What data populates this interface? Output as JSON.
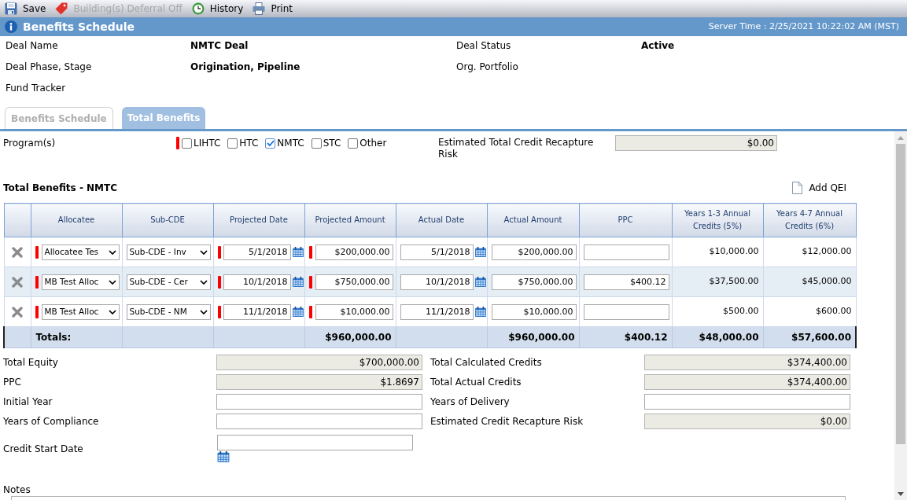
{
  "toolbar": [
    {
      "kind": "save",
      "label": "Save",
      "disabled": false
    },
    {
      "kind": "tag",
      "label": "Building(s) Deferral Off",
      "disabled": true
    },
    {
      "kind": "history",
      "label": "History",
      "disabled": false
    },
    {
      "kind": "print",
      "label": "Print",
      "disabled": false
    }
  ],
  "header": {
    "title": "Benefits Schedule",
    "server_time": "Server Time : 2/25/2021 10:22:02 AM (MST)"
  },
  "deal_info": [
    {
      "fields": [
        {
          "label": "Deal Name",
          "value": "NMTC Deal"
        },
        {
          "label": "Deal Status",
          "value": "Active"
        }
      ]
    },
    {
      "fields": [
        {
          "label": "Deal Phase, Stage",
          "value": "Origination, Pipeline"
        },
        {
          "label": "Org. Portfolio"
        }
      ]
    },
    {
      "fields": [
        {
          "label": "Fund Tracker"
        }
      ]
    }
  ],
  "tabs": [
    {
      "label": "Benefits Schedule",
      "selected": false
    },
    {
      "label": "Total Benefits",
      "selected": true
    }
  ],
  "programs": {
    "label": "Program(s)",
    "required": true,
    "options": [
      {
        "label": "LIHTC",
        "checked": false
      },
      {
        "label": "HTC",
        "checked": false
      },
      {
        "label": "NMTC",
        "checked": true
      },
      {
        "label": "STC",
        "checked": false
      },
      {
        "label": "Other",
        "checked": false
      }
    ]
  },
  "recapture_risk": {
    "label": "Estimated Total Credit Recapture Risk",
    "value": "$0.00"
  },
  "section": {
    "title": "Total Benefits - NMTC",
    "add_button": "Add QEI"
  },
  "table": {
    "columns": [
      {
        "label": "Allocatee",
        "kind": "select",
        "required": true
      },
      {
        "label": "Sub-CDE",
        "kind": "select",
        "required": false
      },
      {
        "label": "Projected Date",
        "kind": "date",
        "required": true
      },
      {
        "label": "Projected Amount",
        "kind": "input",
        "required": true
      },
      {
        "label": "Actual Date",
        "kind": "date",
        "required": false
      },
      {
        "label": "Actual Amount",
        "kind": "input",
        "required": false
      },
      {
        "label": "PPC",
        "kind": "input",
        "required": false
      },
      {
        "label": "Years 1-3 Annual Credits (5%)",
        "kind": "text",
        "required": false
      },
      {
        "label": "Years 4-7 Annual Credits (6%)",
        "kind": "text",
        "required": false
      }
    ],
    "rows": [
      {
        "allocatee": "Allocatee Tes",
        "sub_cde": "Sub-CDE - Inv",
        "projected_date": "5/1/2018",
        "projected_amount": "$200,000.00",
        "actual_date": "5/1/2018",
        "actual_amount": "$200,000.00",
        "credits_years_1_3": "$10,000.00",
        "credits_years_4_7": "$12,000.00"
      },
      {
        "allocatee": "MB Test Alloc",
        "sub_cde": "Sub-CDE - Cer",
        "projected_date": "10/1/2018",
        "projected_amount": "$750,000.00",
        "actual_date": "10/1/2018",
        "actual_amount": "$750,000.00",
        "ppc": "$400.12",
        "credits_years_1_3": "$37,500.00",
        "credits_years_4_7": "$45,000.00"
      },
      {
        "allocatee": "MB Test Alloc",
        "sub_cde": "Sub-CDE - NM",
        "projected_date": "11/1/2018",
        "projected_amount": "$10,000.00",
        "actual_date": "11/1/2018",
        "actual_amount": "$10,000.00",
        "credits_years_1_3": "$500.00",
        "credits_years_4_7": "$600.00"
      }
    ],
    "totals": {
      "label": "Totals:",
      "projected_amount": "$960,000.00",
      "actual_amount": "$960,000.00",
      "ppc": "$400.12",
      "credits_years_1_3": "$48,000.00",
      "credits_years_4_7": "$57,600.00"
    }
  },
  "summary": {
    "left": [
      {
        "label": "Total Equity",
        "value": "$700,000.00",
        "readonly": true
      },
      {
        "label": "PPC",
        "value": "$1.8697",
        "readonly": true
      },
      {
        "label": "Initial Year",
        "readonly": false
      },
      {
        "label": "Years of Compliance",
        "readonly": false
      }
    ],
    "right": [
      {
        "label": "Total Calculated Credits",
        "value": "$374,400.00",
        "readonly": true
      },
      {
        "label": "Total Actual Credits",
        "value": "$374,400.00",
        "readonly": true
      },
      {
        "label": "Years of Delivery",
        "readonly": false
      },
      {
        "label": "Estimated Credit Recapture Risk",
        "value": "$0.00",
        "readonly": true
      }
    ],
    "credit_start_date": {
      "label": "Credit Start Date"
    }
  },
  "notes": {
    "label": "Notes"
  }
}
